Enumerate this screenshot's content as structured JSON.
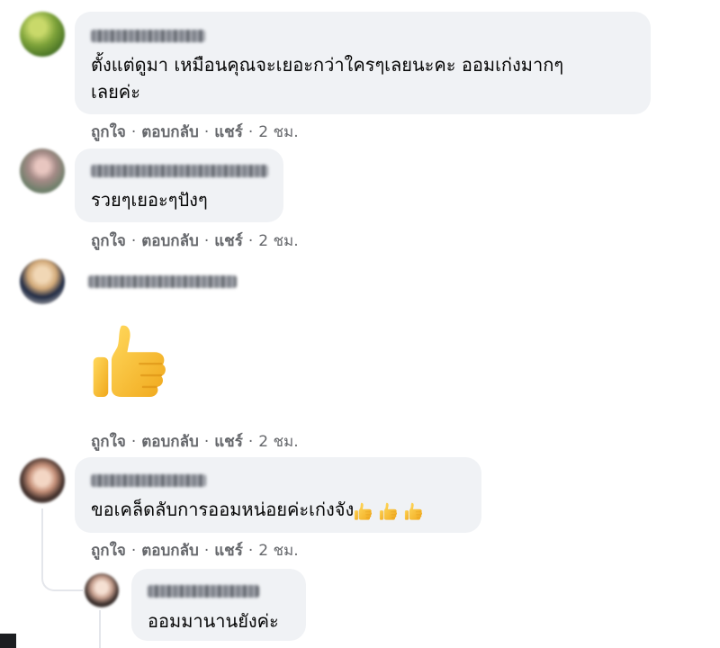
{
  "comments": [
    {
      "text_line1": "ตั้งแต่ดูมา เหมือนคุณจะเยอะกว่าใครๆเลยนะคะ ออมเก่งมากๆ",
      "text_line2": "เลยค่ะ",
      "actions": {
        "like": "ถูกใจ",
        "reply": "ตอบกลับ",
        "share": "แชร์",
        "time": "2 ชม."
      }
    },
    {
      "text_line1": "รวยๆเยอะๆปังๆ",
      "actions": {
        "like": "ถูกใจ",
        "reply": "ตอบกลับ",
        "share": "แชร์",
        "time": "2 ชม."
      }
    },
    {
      "sticker": "thumbs-up-emoji",
      "actions": {
        "like": "ถูกใจ",
        "reply": "ตอบกลับ",
        "share": "แชร์",
        "time": "2 ชม."
      }
    },
    {
      "text_line1": "ขอเคล็ดลับการออมหน่อยค่ะเก่งจัง",
      "trailing_emoji": "thumbs-up-emoji x3",
      "actions": {
        "like": "ถูกใจ",
        "reply": "ตอบกลับ",
        "share": "แชร์",
        "time": "2 ชม."
      }
    }
  ],
  "reply": {
    "text_line1": "ออมมานานยังค่ะ"
  },
  "separator": "·",
  "colors": {
    "bubble": "#f0f2f5",
    "action_text": "#65676b",
    "body_text": "#050505",
    "thumb_yellow": "#ffc83d"
  }
}
